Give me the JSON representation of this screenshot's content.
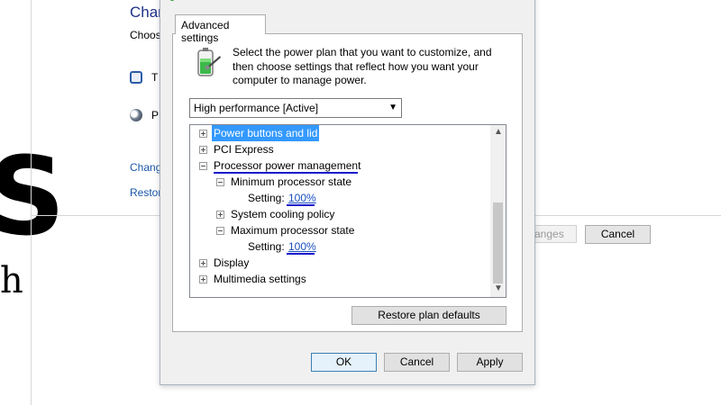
{
  "background": {
    "title": "Char",
    "subtitle": "Choos",
    "item1_label": "T",
    "item2_label": "P",
    "link1": "Chang",
    "link2": "Restor",
    "save_label": "anges",
    "cancel_label": "Cancel",
    "side_letter_big": "S",
    "side_letter_small": "h"
  },
  "dialog": {
    "tab_label": "Advanced settings",
    "instruction": "Select the power plan that you want to customize, and then choose settings that reflect how you want your computer to manage power.",
    "plan_select": "High performance [Active]",
    "tree": [
      {
        "label": "Power buttons and lid",
        "state": "collapsed",
        "selected": true
      },
      {
        "label": "PCI Express",
        "state": "collapsed"
      },
      {
        "label": "Processor power management",
        "state": "expanded"
      },
      {
        "label": "Minimum processor state",
        "state": "expanded"
      },
      {
        "setting_label": "Setting:",
        "value": "100%"
      },
      {
        "label": "System cooling policy",
        "state": "collapsed"
      },
      {
        "label": "Maximum processor state",
        "state": "expanded"
      },
      {
        "setting_label": "Setting:",
        "value": "100%"
      },
      {
        "label": "Display",
        "state": "collapsed"
      },
      {
        "label": "Multimedia settings",
        "state": "collapsed"
      }
    ],
    "restore_defaults_label": "Restore plan defaults",
    "ok_label": "OK",
    "cancel_label": "Cancel",
    "apply_label": "Apply"
  },
  "colors": {
    "selection": "#3399ff",
    "link": "#1a4fbf",
    "annotation_underline": "#1a1acb"
  }
}
